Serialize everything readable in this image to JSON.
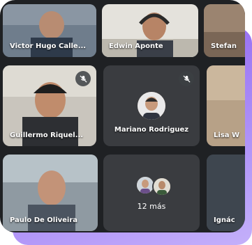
{
  "participants": [
    {
      "name": "Victor Hugo Calle...",
      "muted": false
    },
    {
      "name": "Edwin Aponte",
      "muted": false
    },
    {
      "name": "Stefan",
      "muted": false
    },
    {
      "name": "Guillermo Riquel...",
      "muted": true
    },
    {
      "name": "Mariano Rodriguez",
      "muted": true
    },
    {
      "name": "Lisa W",
      "muted": false
    },
    {
      "name": "Paulo De Oliveira",
      "muted": false
    },
    {
      "name": "Ignác",
      "muted": false
    }
  ],
  "overflow": {
    "label": "12 más"
  },
  "colors": {
    "frame_bg": "#1f2124",
    "avatar_tile_bg": "#3a3c40",
    "accent_purple": "#8a5cf0"
  },
  "icons": {
    "muted": "mic-off-icon"
  }
}
